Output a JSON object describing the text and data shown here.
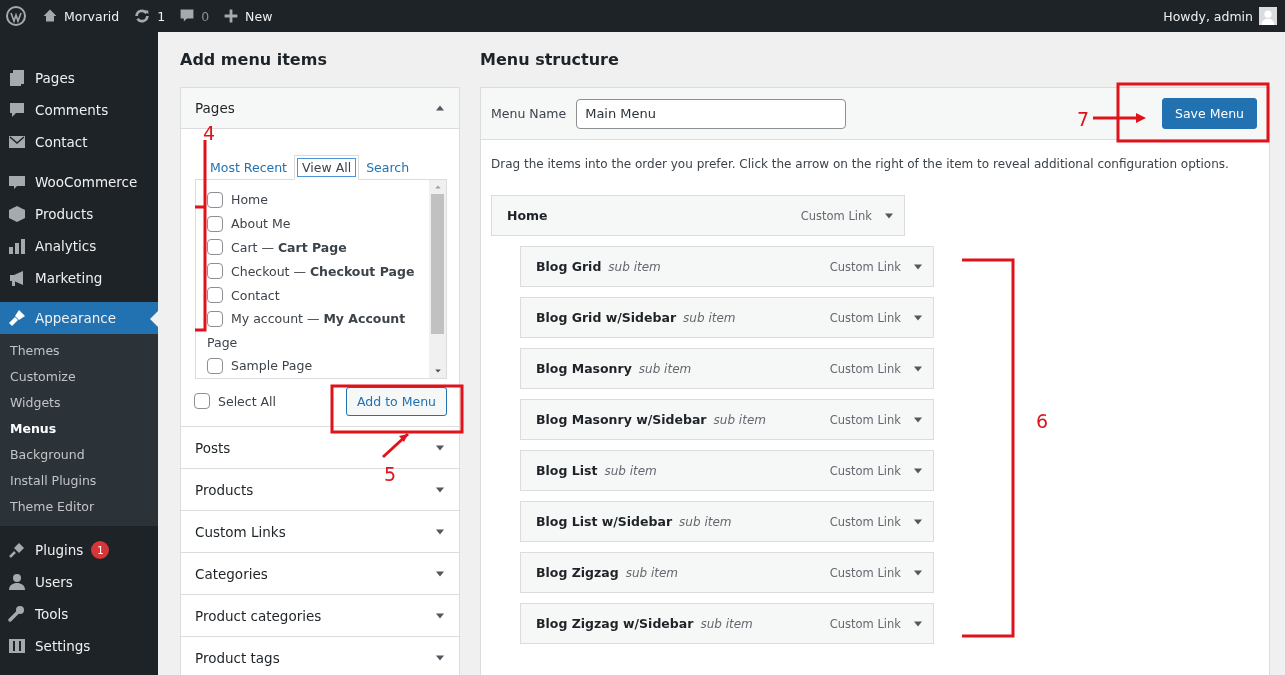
{
  "admin_bar": {
    "site": "Morvarid",
    "updates": "1",
    "comments": "0",
    "new": "New",
    "greeting": "Howdy, admin"
  },
  "sidebar": {
    "items": [
      {
        "label": "Pages",
        "selected": false
      },
      {
        "label": "Comments",
        "selected": false
      },
      {
        "label": "Contact",
        "selected": false
      },
      {
        "label": "WooCommerce",
        "selected": false
      },
      {
        "label": "Products",
        "selected": false
      },
      {
        "label": "Analytics",
        "selected": false
      },
      {
        "label": "Marketing",
        "selected": false
      },
      {
        "label": "Appearance",
        "selected": true,
        "children": [
          {
            "label": "Themes",
            "selected": false
          },
          {
            "label": "Customize",
            "selected": false
          },
          {
            "label": "Widgets",
            "selected": false
          },
          {
            "label": "Menus",
            "selected": true
          },
          {
            "label": "Background",
            "selected": false
          },
          {
            "label": "Install Plugins",
            "selected": false
          },
          {
            "label": "Theme Editor",
            "selected": false
          }
        ]
      },
      {
        "label": "Plugins",
        "selected": false,
        "badge": "1"
      },
      {
        "label": "Users",
        "selected": false
      },
      {
        "label": "Tools",
        "selected": false
      },
      {
        "label": "Settings",
        "selected": false
      }
    ]
  },
  "add_items": {
    "title": "Add menu items",
    "sections": [
      {
        "title": "Pages",
        "expanded": true,
        "tabs": [
          {
            "label": "Most Recent",
            "selected": false
          },
          {
            "label": "View All",
            "selected": true
          },
          {
            "label": "Search",
            "selected": false
          }
        ],
        "items": [
          {
            "kind": "checkbox",
            "label": "Home",
            "checked": false
          },
          {
            "kind": "checkbox",
            "label": "About Me",
            "checked": false
          },
          {
            "kind": "checkbox",
            "label": "Cart — **Cart Page**",
            "checked": false
          },
          {
            "kind": "checkbox",
            "label": "Checkout — **Checkout Page**",
            "checked": false
          },
          {
            "kind": "checkbox",
            "label": "Contact",
            "checked": false
          },
          {
            "kind": "checkbox",
            "label": "My account — **My Account**",
            "checked": false
          },
          {
            "kind": "heading",
            "label": "Page"
          },
          {
            "kind": "checkbox",
            "label": "Sample Page",
            "checked": false
          }
        ],
        "select_all": {
          "label": "Select All",
          "checked": false
        },
        "button": "Add to Menu"
      },
      {
        "title": "Posts",
        "expanded": false
      },
      {
        "title": "Products",
        "expanded": false
      },
      {
        "title": "Custom Links",
        "expanded": false
      },
      {
        "title": "Categories",
        "expanded": false
      },
      {
        "title": "Product categories",
        "expanded": false
      },
      {
        "title": "Product tags",
        "expanded": false
      }
    ]
  },
  "menu_structure": {
    "title": "Menu structure",
    "menu_name_label": "Menu Name",
    "menu_name": "Main Menu",
    "save_button": "Save Menu",
    "instructions": "Drag the items into the order you prefer. Click the arrow on the right of the item to reveal additional configuration options.",
    "items": [
      {
        "label": "Home",
        "type": "Custom Link",
        "children": [
          {
            "label": "Blog Grid",
            "note": "sub item",
            "type": "Custom Link"
          },
          {
            "label": "Blog Grid w/Sidebar",
            "note": "sub item",
            "type": "Custom Link"
          },
          {
            "label": "Blog Masonry",
            "note": "sub item",
            "type": "Custom Link"
          },
          {
            "label": "Blog Masonry w/Sidebar",
            "note": "sub item",
            "type": "Custom Link"
          },
          {
            "label": "Blog List",
            "note": "sub item",
            "type": "Custom Link"
          },
          {
            "label": "Blog List w/Sidebar",
            "note": "sub item",
            "type": "Custom Link"
          },
          {
            "label": "Blog Zigzag",
            "note": "sub item",
            "type": "Custom Link"
          },
          {
            "label": "Blog Zigzag w/Sidebar",
            "note": "sub item",
            "type": "Custom Link"
          }
        ]
      }
    ]
  },
  "annotations": [
    {
      "kind": "left-bracket",
      "label": "4"
    },
    {
      "kind": "box-below",
      "label": "5"
    },
    {
      "kind": "right-bracket",
      "label": "6"
    },
    {
      "kind": "box-left",
      "label": "7"
    }
  ]
}
